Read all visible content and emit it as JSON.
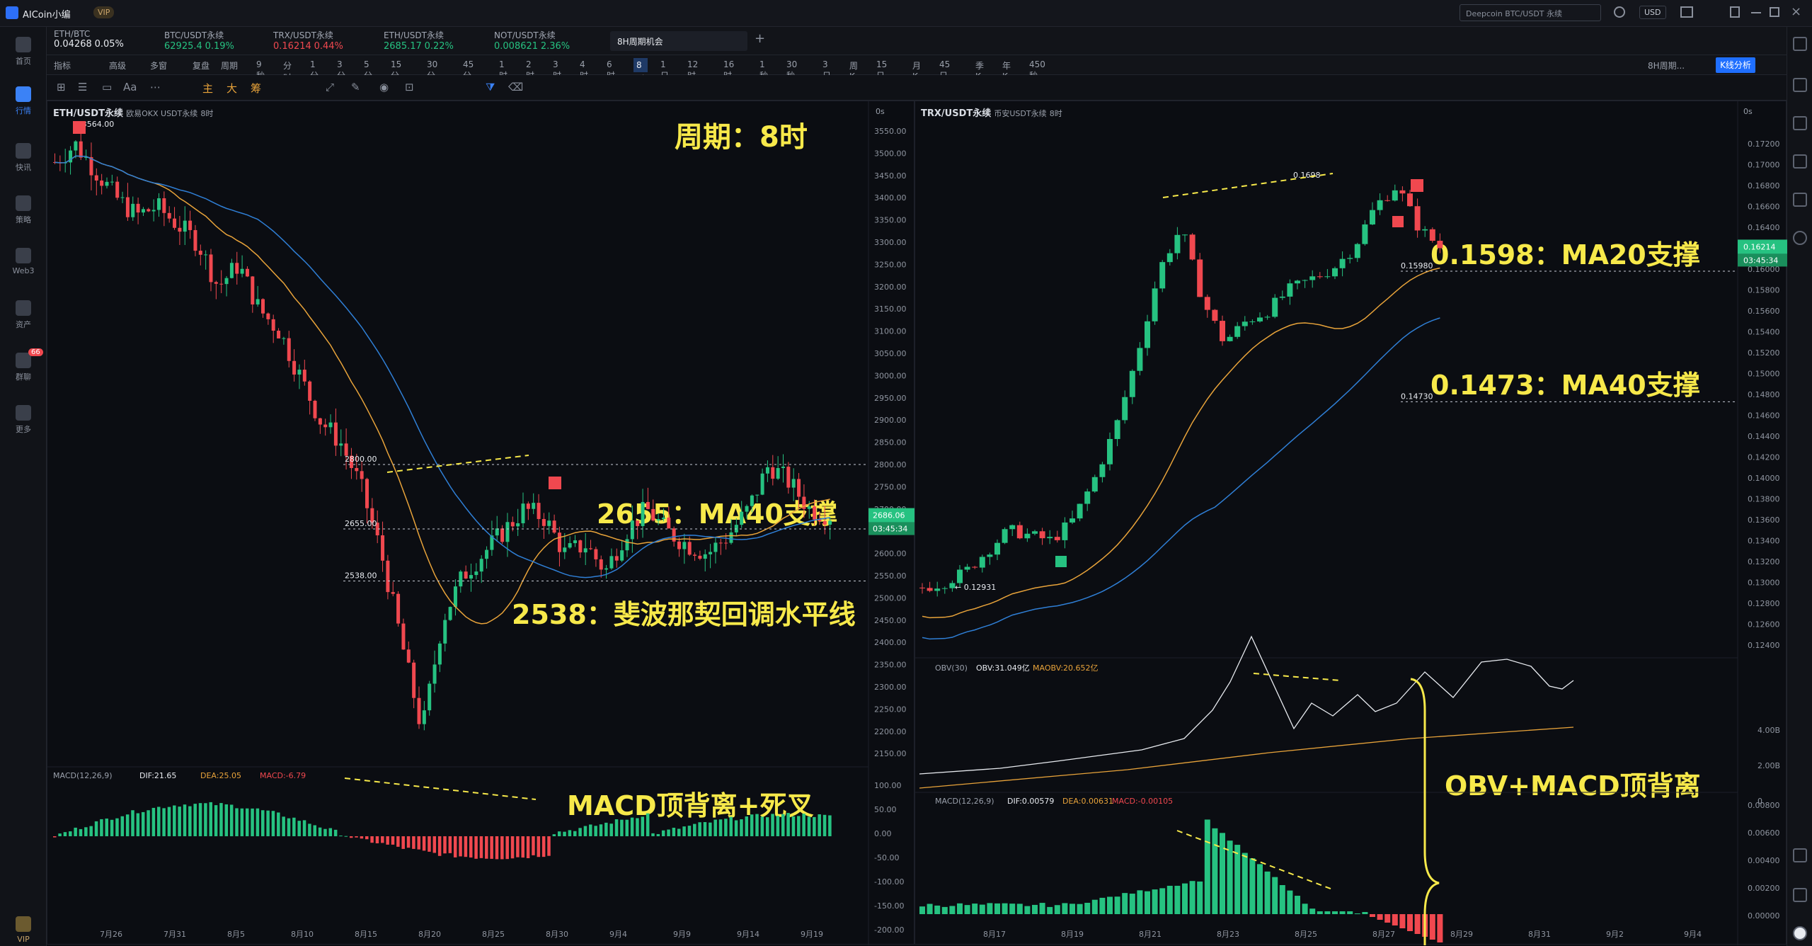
{
  "app": {
    "title": "AICoin小编",
    "vip": "VIP",
    "search_placeholder": "Deepcoin BTC/USDT 永续",
    "currency": "USD"
  },
  "nav": {
    "items": [
      {
        "label": "首页"
      },
      {
        "label": "行情"
      },
      {
        "label": "快讯"
      },
      {
        "label": "策略"
      },
      {
        "label": "Web3"
      },
      {
        "label": "资产"
      },
      {
        "label": "群聊",
        "badge": "66"
      },
      {
        "label": "更多"
      }
    ],
    "bottom": "VIP"
  },
  "tickers": [
    {
      "name": "ETH/BTC",
      "price": "0.04268",
      "change": "0.05%",
      "dir": "wt"
    },
    {
      "name": "BTC/USDT永续",
      "price": "62925.4",
      "change": "0.19%",
      "dir": "up"
    },
    {
      "name": "TRX/USDT永续",
      "price": "0.16214",
      "change": "0.44%",
      "dir": "dn"
    },
    {
      "name": "ETH/USDT永续",
      "price": "2685.17",
      "change": "0.22%",
      "dir": "up"
    },
    {
      "name": "NOT/USDT永续",
      "price": "0.008621",
      "change": "2.36%",
      "dir": "up"
    }
  ],
  "active_tab": "8H周期机会",
  "toolbar": {
    "items": [
      "指标",
      "高级",
      "多窗",
      "复盘",
      "周期"
    ],
    "periods": [
      "9秒",
      "分时",
      "1分",
      "3分",
      "5分",
      "15分",
      "30分",
      "45分",
      "1时",
      "2时",
      "3时",
      "4时",
      "6时",
      "8时",
      "1日",
      "12时",
      "16时",
      "1秒",
      "30秒",
      "3日",
      "周K",
      "15日",
      "月K",
      "45日",
      "季K",
      "年K",
      "450秒"
    ],
    "selected": "8时",
    "analysis": "K线分析",
    "layout": "8H周期..."
  },
  "drawtools": [
    "主",
    "大",
    "筹"
  ],
  "left_chart": {
    "symbol": "ETH/USDT永续",
    "exchange": "欧易OKX USDT永续",
    "period": "8时",
    "timer": "0s",
    "high_label": "← 3564.00",
    "yticks": [
      "3550.00",
      "3500.00",
      "3450.00",
      "3400.00",
      "3350.00",
      "3300.00",
      "3250.00",
      "3200.00",
      "3150.00",
      "3100.00",
      "3050.00",
      "3000.00",
      "2950.00",
      "2900.00",
      "2850.00",
      "2800.00",
      "2750.00",
      "2700.00",
      "2650.00",
      "2600.00",
      "2550.00",
      "2500.00",
      "2450.00",
      "2400.00",
      "2350.00",
      "2300.00",
      "2250.00",
      "2200.00",
      "2150.00"
    ],
    "level_2800": "2800.00",
    "level_2655": "2655.00",
    "level_2538": "2538.00",
    "price_tag": "2686.06",
    "countdown": "03:45:34",
    "notes": {
      "period": "周期：8时",
      "ma40": "2655：MA40支撑",
      "fib": "2538：斐波那契回调水平线",
      "macd": "MACD顶背离+死叉"
    },
    "macd": {
      "label": "MACD(12,26,9)",
      "dif": "DIF:21.65",
      "dea": "DEA:25.05",
      "macd": "MACD:-6.79",
      "yticks": [
        "100.00",
        "50.00",
        "0.00",
        "-50.00",
        "-100.00",
        "-150.00",
        "-200.00"
      ]
    },
    "xticks": [
      "7月26",
      "7月31",
      "8月5",
      "8月10",
      "8月15",
      "8月20",
      "8月25",
      "8月30",
      "9月4",
      "9月9",
      "9月14",
      "9月19"
    ]
  },
  "right_chart": {
    "symbol": "TRX/USDT永续",
    "exchange": "币安USDT永续",
    "period": "8时",
    "timer": "0s",
    "yticks": [
      "0.17200",
      "0.17000",
      "0.16800",
      "0.16600",
      "0.16400",
      "0.16200",
      "0.16000",
      "0.15800",
      "0.15600",
      "0.15400",
      "0.15200",
      "0.15000",
      "0.14800",
      "0.14600",
      "0.14400",
      "0.14200",
      "0.14000",
      "0.13800",
      "0.13600",
      "0.13400",
      "0.13200",
      "0.13000",
      "0.12800",
      "0.12600",
      "0.12400"
    ],
    "high_label": "0.1698",
    "low_label": "← 0.12931",
    "level_ma20": "0.15980",
    "level_ma40": "0.14730",
    "price_tag": "0.16214",
    "countdown": "03:45:34",
    "notes": {
      "ma20": "0.1598：MA20支撑",
      "ma40": "0.1473：MA40支撑",
      "obvmacd": "OBV+MACD顶背离"
    },
    "obv": {
      "label": "OBV(30)",
      "obv": "OBV:31.049亿",
      "maobv": "MAOBV:20.652亿",
      "yticks": [
        "4.00B",
        "2.00B",
        "0"
      ]
    },
    "macd": {
      "label": "MACD(12,26,9)",
      "dif": "DIF:0.00579",
      "dea": "DEA:0.00631",
      "macd": "MACD:-0.00105",
      "yticks": [
        "0.00800",
        "0.00600",
        "0.00400",
        "0.00200",
        "0.00000"
      ]
    },
    "xticks": [
      "8月17",
      "8月19",
      "8月21",
      "8月23",
      "8月25",
      "8月27",
      "8月29",
      "8月31",
      "9月2",
      "9月4"
    ]
  },
  "colors": {
    "up": "#26c281",
    "down": "#f0484f",
    "note": "#f7e94a",
    "ma_orange": "#e8a33a",
    "ma_blue": "#2f7fd6",
    "accent": "#1f6fff"
  }
}
